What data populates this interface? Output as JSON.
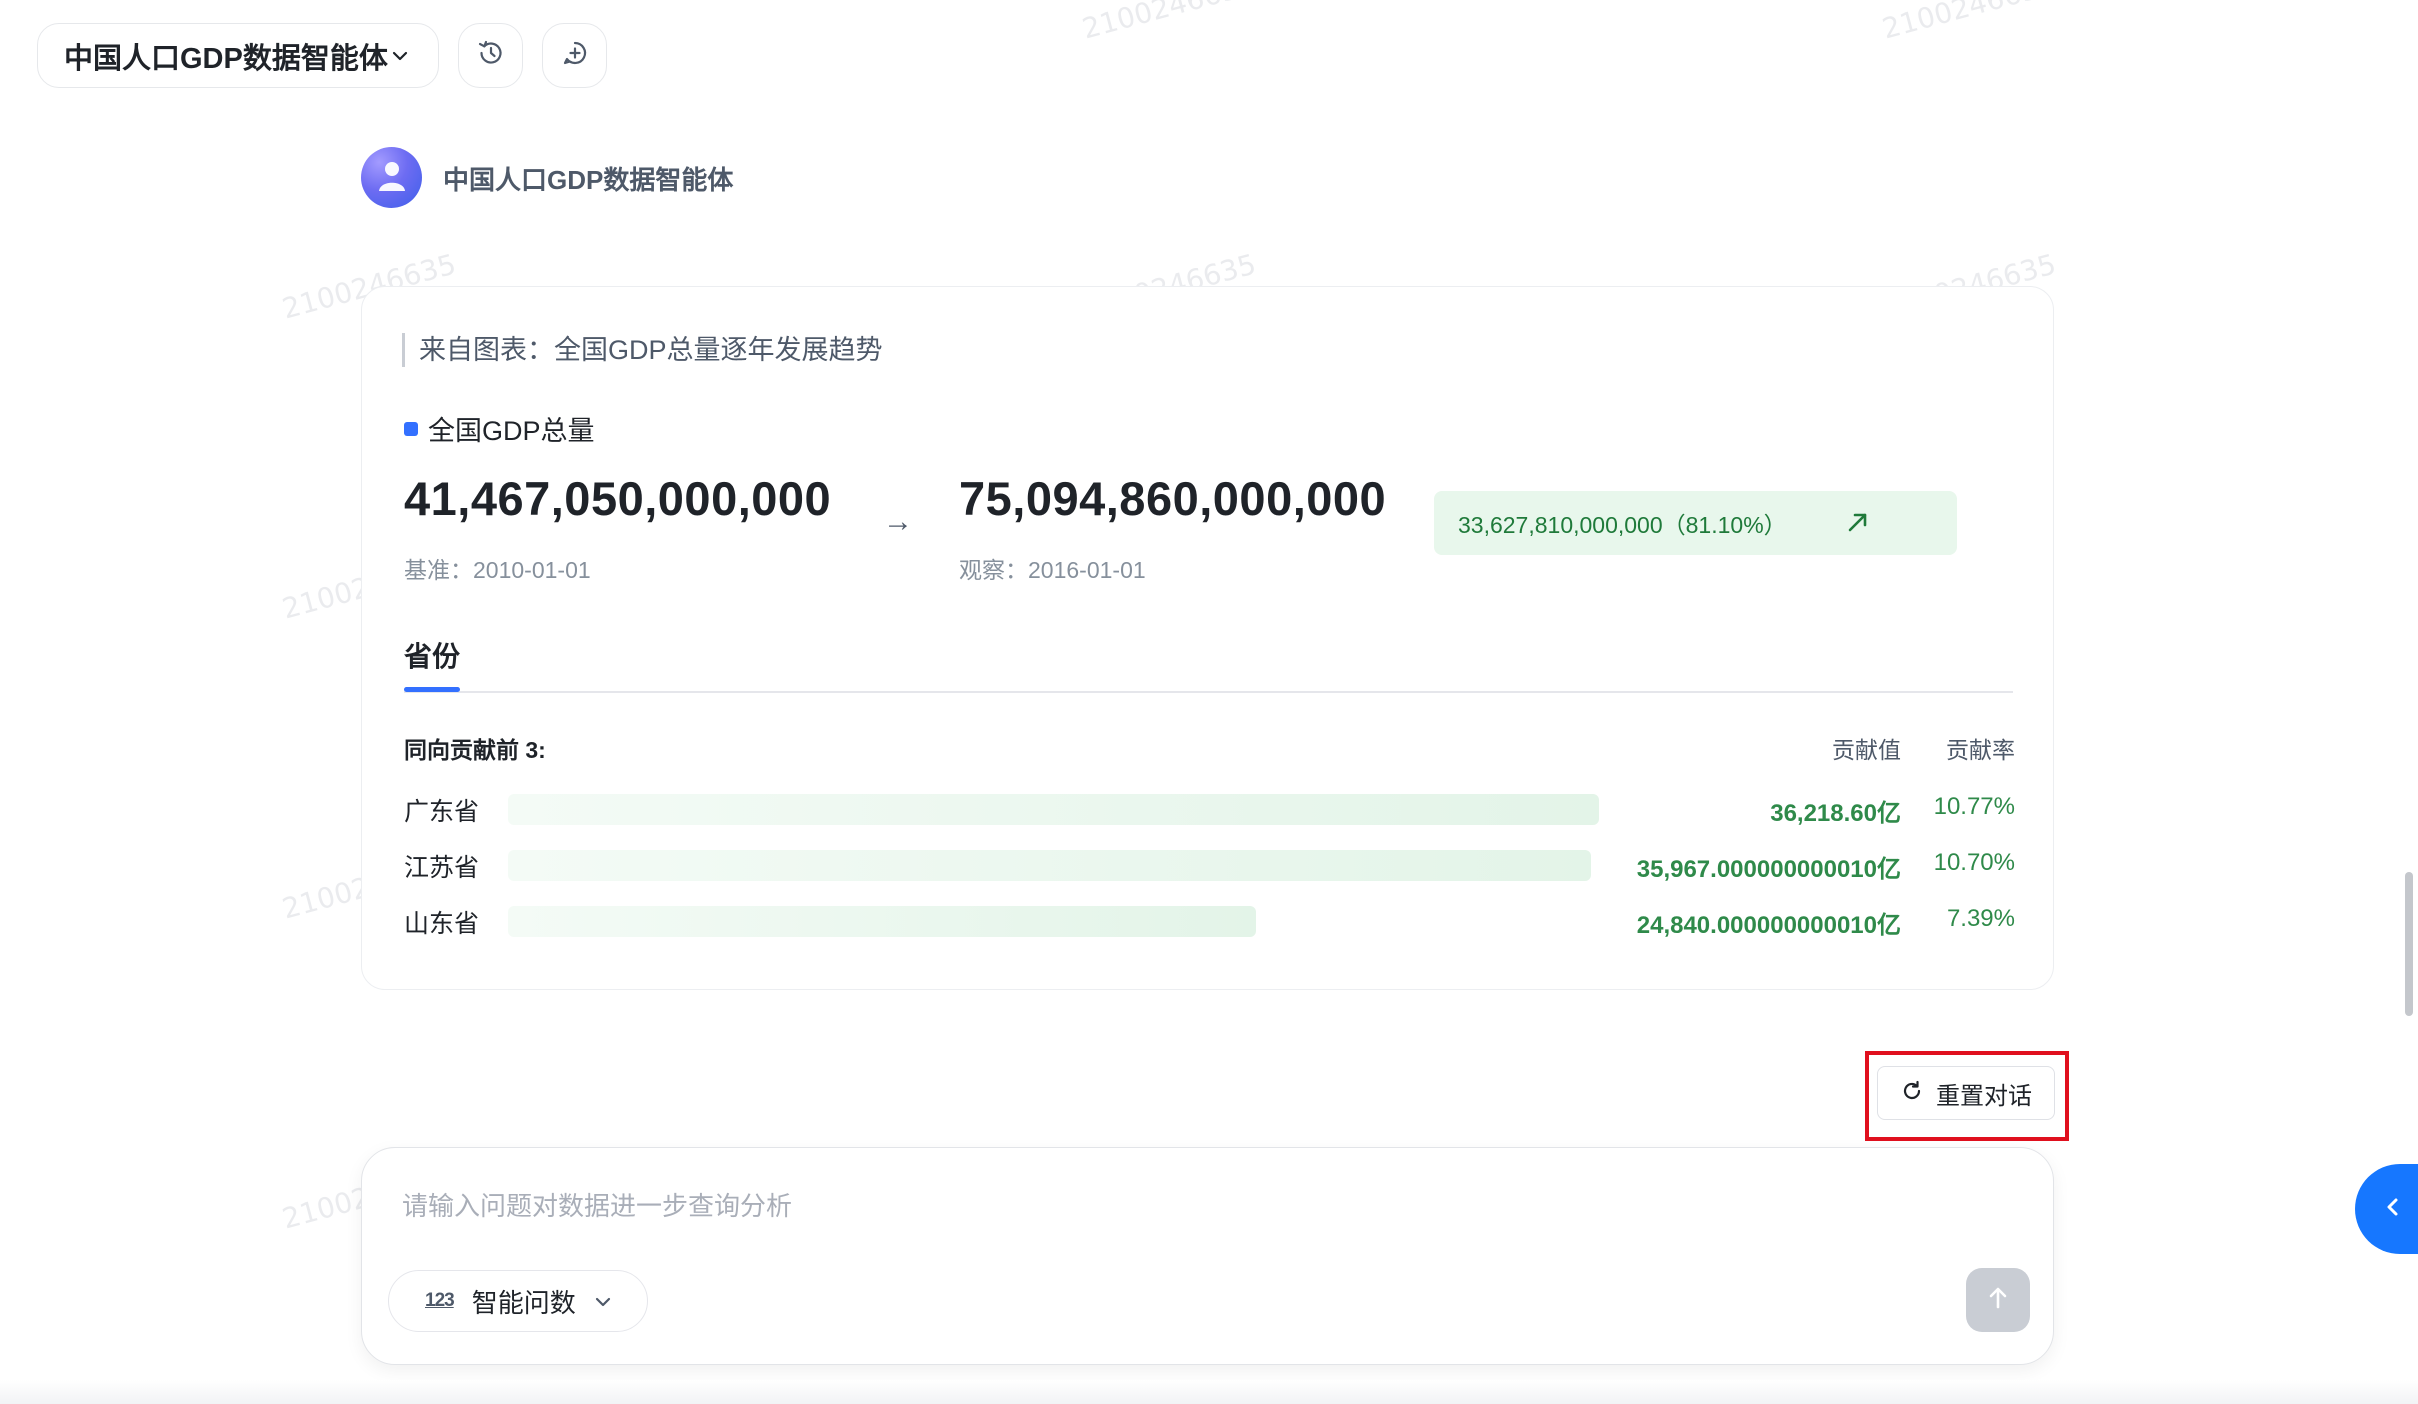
{
  "header": {
    "agent_selector_label": "中国人口GDP数据智能体",
    "history_icon": "history-icon",
    "new_chat_icon": "new-chat-icon"
  },
  "agent": {
    "name": "中国人口GDP数据智能体",
    "avatar_icon": "user-avatar-icon"
  },
  "card": {
    "source_text": "来自图表：全国GDP总量逐年发展趋势",
    "metric_name": "全国GDP总量",
    "metric_color": "#3370ff",
    "base_value": "41,467,050,000,000",
    "base_date": "基准：2010-01-01",
    "arrow": "→",
    "observed_value": "75,094,860,000,000",
    "observed_date": "观察：2016-01-01",
    "change_text": "33,627,810,000,000（81.10%）",
    "change_icon": "trend-up-icon",
    "tab_label": "省份",
    "contrib_title": "同向贡献前 3:",
    "col_value": "贡献值",
    "col_rate": "贡献率",
    "rows": [
      {
        "label": "广东省",
        "value": "36,218.60亿",
        "rate": "10.77%",
        "share": 1.0
      },
      {
        "label": "江苏省",
        "value": "35,967.000000000010亿",
        "rate": "10.70%",
        "share": 0.993
      },
      {
        "label": "山东省",
        "value": "24,840.000000000010亿",
        "rate": "7.39%",
        "share": 0.686
      }
    ],
    "positive_color": "#2f8a4a"
  },
  "reset_button": {
    "label": "重置对话",
    "icon": "refresh-icon"
  },
  "composer": {
    "placeholder": "请输入问题对数据进一步查询分析",
    "mode_badge": "123",
    "mode_label": "智能问数",
    "send_icon": "arrow-up-icon"
  },
  "side_toggle_icon": "chevron-left-icon",
  "watermark_text": "2100246635",
  "colors": {
    "accent": "#3370ff",
    "highlight_border": "#e0101e",
    "side_toggle": "#1677ff"
  }
}
